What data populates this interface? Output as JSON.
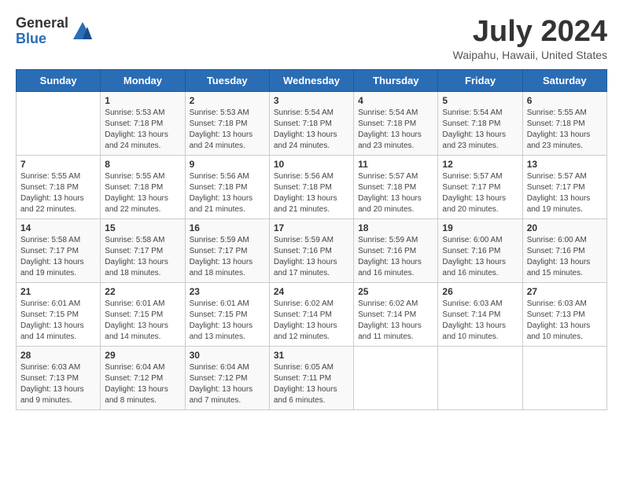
{
  "logo": {
    "general": "General",
    "blue": "Blue"
  },
  "title": "July 2024",
  "location": "Waipahu, Hawaii, United States",
  "days_of_week": [
    "Sunday",
    "Monday",
    "Tuesday",
    "Wednesday",
    "Thursday",
    "Friday",
    "Saturday"
  ],
  "weeks": [
    [
      {
        "day": "",
        "info": ""
      },
      {
        "day": "1",
        "info": "Sunrise: 5:53 AM\nSunset: 7:18 PM\nDaylight: 13 hours\nand 24 minutes."
      },
      {
        "day": "2",
        "info": "Sunrise: 5:53 AM\nSunset: 7:18 PM\nDaylight: 13 hours\nand 24 minutes."
      },
      {
        "day": "3",
        "info": "Sunrise: 5:54 AM\nSunset: 7:18 PM\nDaylight: 13 hours\nand 24 minutes."
      },
      {
        "day": "4",
        "info": "Sunrise: 5:54 AM\nSunset: 7:18 PM\nDaylight: 13 hours\nand 23 minutes."
      },
      {
        "day": "5",
        "info": "Sunrise: 5:54 AM\nSunset: 7:18 PM\nDaylight: 13 hours\nand 23 minutes."
      },
      {
        "day": "6",
        "info": "Sunrise: 5:55 AM\nSunset: 7:18 PM\nDaylight: 13 hours\nand 23 minutes."
      }
    ],
    [
      {
        "day": "7",
        "info": ""
      },
      {
        "day": "8",
        "info": "Sunrise: 5:55 AM\nSunset: 7:18 PM\nDaylight: 13 hours\nand 22 minutes."
      },
      {
        "day": "9",
        "info": "Sunrise: 5:56 AM\nSunset: 7:18 PM\nDaylight: 13 hours\nand 21 minutes."
      },
      {
        "day": "10",
        "info": "Sunrise: 5:56 AM\nSunset: 7:18 PM\nDaylight: 13 hours\nand 21 minutes."
      },
      {
        "day": "11",
        "info": "Sunrise: 5:57 AM\nSunset: 7:18 PM\nDaylight: 13 hours\nand 20 minutes."
      },
      {
        "day": "12",
        "info": "Sunrise: 5:57 AM\nSunset: 7:17 PM\nDaylight: 13 hours\nand 20 minutes."
      },
      {
        "day": "13",
        "info": "Sunrise: 5:57 AM\nSunset: 7:17 PM\nDaylight: 13 hours\nand 19 minutes."
      }
    ],
    [
      {
        "day": "14",
        "info": ""
      },
      {
        "day": "15",
        "info": "Sunrise: 5:58 AM\nSunset: 7:17 PM\nDaylight: 13 hours\nand 18 minutes."
      },
      {
        "day": "16",
        "info": "Sunrise: 5:59 AM\nSunset: 7:17 PM\nDaylight: 13 hours\nand 18 minutes."
      },
      {
        "day": "17",
        "info": "Sunrise: 5:59 AM\nSunset: 7:16 PM\nDaylight: 13 hours\nand 17 minutes."
      },
      {
        "day": "18",
        "info": "Sunrise: 5:59 AM\nSunset: 7:16 PM\nDaylight: 13 hours\nand 16 minutes."
      },
      {
        "day": "19",
        "info": "Sunrise: 6:00 AM\nSunset: 7:16 PM\nDaylight: 13 hours\nand 16 minutes."
      },
      {
        "day": "20",
        "info": "Sunrise: 6:00 AM\nSunset: 7:16 PM\nDaylight: 13 hours\nand 15 minutes."
      }
    ],
    [
      {
        "day": "21",
        "info": ""
      },
      {
        "day": "22",
        "info": "Sunrise: 6:01 AM\nSunset: 7:15 PM\nDaylight: 13 hours\nand 14 minutes."
      },
      {
        "day": "23",
        "info": "Sunrise: 6:01 AM\nSunset: 7:15 PM\nDaylight: 13 hours\nand 13 minutes."
      },
      {
        "day": "24",
        "info": "Sunrise: 6:02 AM\nSunset: 7:14 PM\nDaylight: 13 hours\nand 12 minutes."
      },
      {
        "day": "25",
        "info": "Sunrise: 6:02 AM\nSunset: 7:14 PM\nDaylight: 13 hours\nand 11 minutes."
      },
      {
        "day": "26",
        "info": "Sunrise: 6:03 AM\nSunset: 7:14 PM\nDaylight: 13 hours\nand 10 minutes."
      },
      {
        "day": "27",
        "info": "Sunrise: 6:03 AM\nSunset: 7:13 PM\nDaylight: 13 hours\nand 10 minutes."
      }
    ],
    [
      {
        "day": "28",
        "info": "Sunrise: 6:03 AM\nSunset: 7:13 PM\nDaylight: 13 hours\nand 9 minutes."
      },
      {
        "day": "29",
        "info": "Sunrise: 6:04 AM\nSunset: 7:12 PM\nDaylight: 13 hours\nand 8 minutes."
      },
      {
        "day": "30",
        "info": "Sunrise: 6:04 AM\nSunset: 7:12 PM\nDaylight: 13 hours\nand 7 minutes."
      },
      {
        "day": "31",
        "info": "Sunrise: 6:05 AM\nSunset: 7:11 PM\nDaylight: 13 hours\nand 6 minutes."
      },
      {
        "day": "",
        "info": ""
      },
      {
        "day": "",
        "info": ""
      },
      {
        "day": "",
        "info": ""
      }
    ]
  ],
  "week1_sunday_info": "Sunrise: 5:55 AM\nSunset: 7:18 PM\nDaylight: 13 hours\nand 22 minutes.",
  "week3_sunday_info": "Sunrise: 5:58 AM\nSunset: 7:17 PM\nDaylight: 13 hours\nand 19 minutes.",
  "week4_sunday_info": "Sunrise: 6:01 AM\nSunset: 7:15 PM\nDaylight: 13 hours\nand 14 minutes."
}
